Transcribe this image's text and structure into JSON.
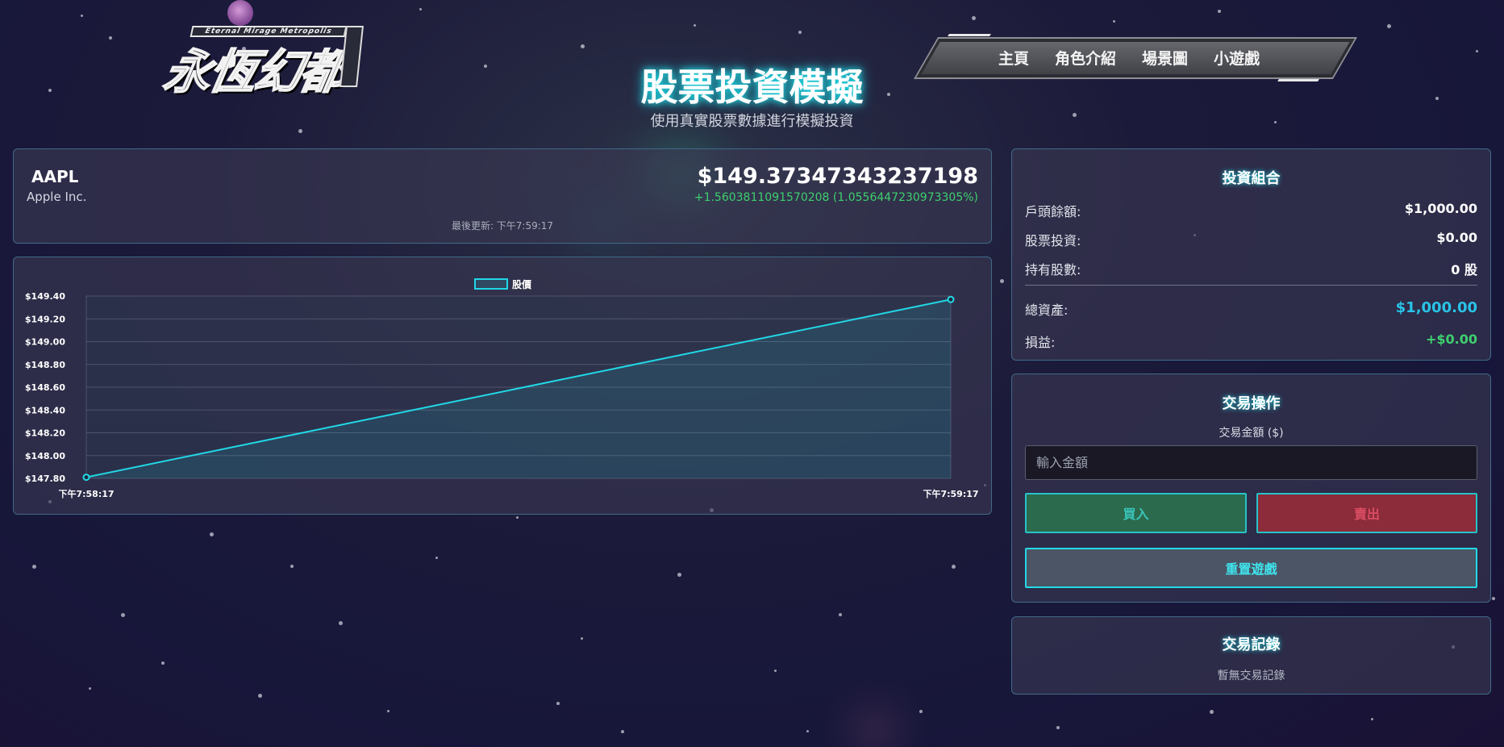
{
  "logo": {
    "subtitle": "Eternal Mirage Metropolis",
    "main": "永恆幻都"
  },
  "nav": {
    "items": [
      "主頁",
      "角色介紹",
      "場景圖",
      "小遊戲"
    ]
  },
  "header": {
    "title": "股票投資模擬",
    "subtitle": "使用真實股票數據進行模擬投資"
  },
  "stock": {
    "ticker": "AAPL",
    "company": "Apple Inc.",
    "price": "$149.37347343237198",
    "change": "+1.5603811091570208 (1.0556447230973305%)",
    "updated": "最後更新: 下午7:59:17"
  },
  "chart_data": {
    "type": "line",
    "series": [
      {
        "name": "股價",
        "x": [
          "下午7:58:17",
          "下午7:59:17"
        ],
        "values": [
          147.81,
          149.37
        ]
      }
    ],
    "ylim": [
      147.8,
      149.4
    ],
    "yticks": [
      147.8,
      148.0,
      148.2,
      148.4,
      148.6,
      148.8,
      149.0,
      149.2,
      149.4
    ],
    "ytick_labels": [
      "$147.80",
      "$148.00",
      "$148.20",
      "$148.40",
      "$148.60",
      "$148.80",
      "$149.00",
      "$149.20",
      "$149.40"
    ],
    "legend": "top-center",
    "grid": true,
    "line_color": "#21d8e6"
  },
  "portfolio": {
    "title": "投資組合",
    "rows": [
      {
        "label": "戶頭餘額:",
        "value": "$1,000.00"
      },
      {
        "label": "股票投資:",
        "value": "$0.00"
      },
      {
        "label": "持有股數:",
        "value": "0 股"
      }
    ],
    "total_label": "總資產:",
    "total_value": "$1,000.00",
    "pnl_label": "損益:",
    "pnl_value": "+$0.00"
  },
  "trade": {
    "title": "交易操作",
    "amount_label": "交易金額 ($)",
    "amount_placeholder": "輸入金額",
    "buy_label": "買入",
    "sell_label": "賣出",
    "reset_label": "重置遊戲"
  },
  "history": {
    "title": "交易記錄",
    "empty": "暫無交易記錄"
  },
  "colors": {
    "accent": "#21d8e6",
    "positive": "#3ecf6e",
    "total": "#29c4e8"
  }
}
